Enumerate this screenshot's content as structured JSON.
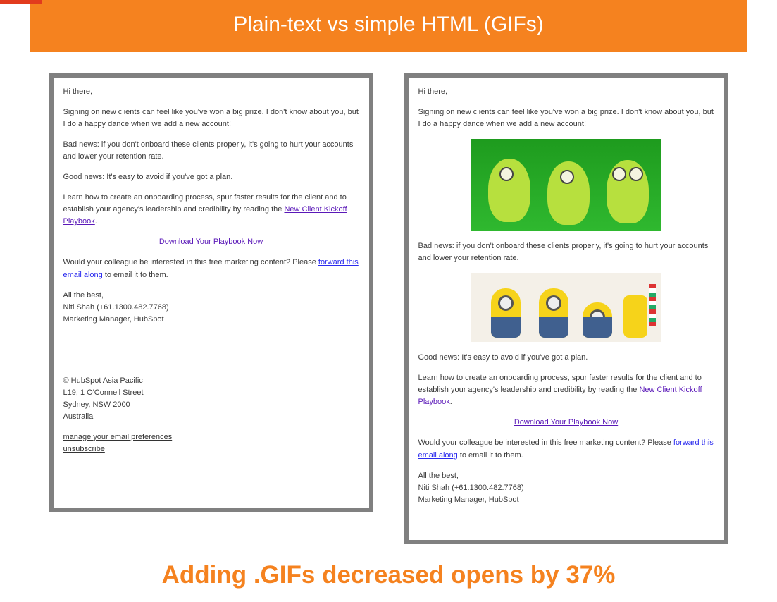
{
  "colors": {
    "accent": "#f5821f"
  },
  "banner": {
    "title": "Plain-text vs simple HTML (GIFs)"
  },
  "email": {
    "greeting": "Hi there,",
    "p1": "Signing on new clients can feel like you've won a big prize. I don't know about you, but I do a happy dance when we add a new account!",
    "p2": "Bad news: if you don't onboard these clients properly, it's going to hurt your accounts and lower your retention rate.",
    "p3": "Good news: It's easy to avoid if you've got a plan.",
    "p4a": "Learn how to create an onboarding process, spur faster results for the client and to establish your agency's leadership and credibility by reading the ",
    "p4_link": "New Client Kickoff Playbook",
    "p4b": ".",
    "cta": "Download Your Playbook Now",
    "p5a": "Would your colleague be interested in this free marketing content? Please ",
    "p5_link": "forward this email along",
    "p5b": " to email it to them.",
    "sig1": "All the best,",
    "sig2": "Niti Shah (+61.1300.482.7768)",
    "sig3": "Marketing Manager, HubSpot",
    "foot1": "© HubSpot Asia Pacific",
    "foot2": "L19, 1 O'Connell Street",
    "foot3": "Sydney, NSW 2000",
    "foot4": "Australia",
    "prefs": "manage your email preferences",
    "unsub": "unsubscribe"
  },
  "footer": {
    "headline": "Adding .GIFs decreased opens by 37%"
  }
}
